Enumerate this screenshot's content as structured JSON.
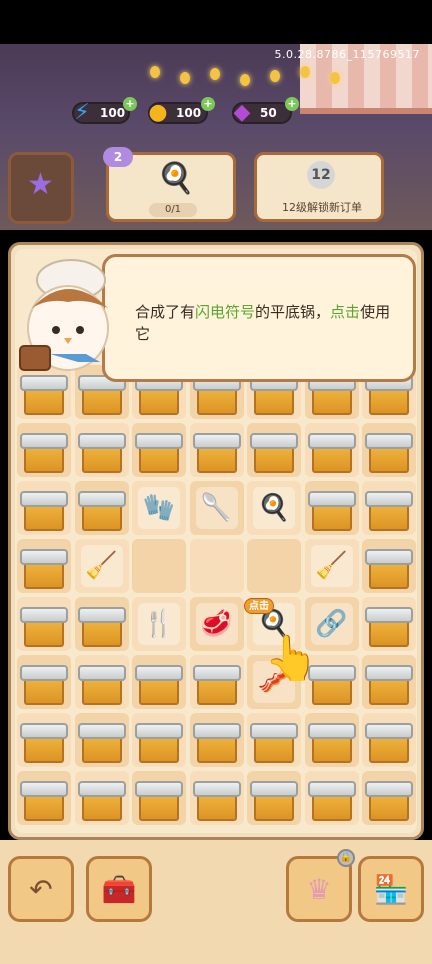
{
  "version": "5.0.28.8786_115769517",
  "resources": [
    {
      "name": "energy",
      "icon": "lightning-icon",
      "value": "100"
    },
    {
      "name": "coins",
      "icon": "coin-icon",
      "value": "100"
    },
    {
      "name": "gems",
      "icon": "gem-icon",
      "value": "50"
    }
  ],
  "quest": {
    "level": "2",
    "progress": "0/1"
  },
  "unlock": {
    "level": "12",
    "text": "12级解锁新订单"
  },
  "tutorial": {
    "pre": "合成了有",
    "highlight": "闪电符号",
    "mid": "的平底锅，",
    "action": "点击",
    "post": "使用它"
  },
  "tap_label": "点击",
  "grid": [
    [
      "crate",
      "crate",
      "crate",
      "crate",
      "crate",
      "crate",
      "crate"
    ],
    [
      "crate",
      "crate",
      "crate",
      "crate",
      "crate",
      "crate",
      "crate"
    ],
    [
      "crate",
      "crate",
      "oven-mitt",
      "spatula",
      "spatulas",
      "crate",
      "crate"
    ],
    [
      "crate",
      "whisk",
      "empty",
      "empty",
      "empty",
      "broom",
      "crate"
    ],
    [
      "crate",
      "crate",
      "pan-scraper",
      "meat",
      "frying-pan",
      "tape",
      "crate"
    ],
    [
      "crate",
      "crate",
      "crate",
      "crate",
      "cutting-board",
      "crate",
      "crate"
    ],
    [
      "crate",
      "crate",
      "crate",
      "crate",
      "crate",
      "crate",
      "crate"
    ],
    [
      "crate",
      "crate",
      "crate",
      "crate",
      "crate",
      "crate",
      "crate"
    ]
  ],
  "item_icons": {
    "oven-mitt": "🧤",
    "spatula": "🥄",
    "spatulas": "🍳",
    "whisk": "🧹",
    "broom": "🧹",
    "pan-scraper": "🍴",
    "meat": "🥩",
    "frying-pan": "🍳",
    "tape": "🔗",
    "cutting-board": "🥓"
  }
}
